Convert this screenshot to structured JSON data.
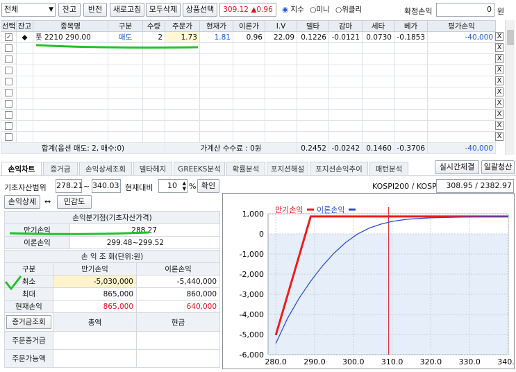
{
  "toolbar": {
    "filter_value": "전체",
    "buttons": [
      "잔고",
      "반전",
      "새로고침",
      "모두삭제",
      "상품선택"
    ],
    "index_value": "309.12",
    "index_change": "▲0.96",
    "radios": [
      {
        "label": "지수",
        "checked": true
      },
      {
        "label": "미니",
        "checked": false
      },
      {
        "label": "위클리",
        "checked": false
      }
    ],
    "realized_label": "확정손익",
    "realized_value": "0",
    "realized_unit": "원"
  },
  "grid": {
    "headers": [
      "선택",
      "잔고",
      "종목명",
      "구분",
      "수량",
      "주문가",
      "현재가",
      "이론가",
      "I.V",
      "델타",
      "감마",
      "세타",
      "베가",
      "평가손익"
    ],
    "row": {
      "checked": true,
      "balance_mark": "◆",
      "name": "풋 2210 290.00",
      "side": "매도",
      "qty": "2",
      "order_price": "1.73",
      "current": "1.81",
      "theory": "0.96",
      "iv": "22.09",
      "delta": "0.1226",
      "gamma": "-0.0121",
      "theta": "0.0730",
      "vega": "-0.1853",
      "pnl": "-40,000"
    },
    "remove_label": "X",
    "summary": {
      "label": "합계(옵션 매도: 2, 매수:0)",
      "fee": "가계산 수수료 : 0원",
      "delta": "0.2452",
      "gamma": "-0.0242",
      "theta": "0.1460",
      "vega": "-0.3706",
      "pnl": "-40,000"
    }
  },
  "tabs": [
    "손익차트",
    "증거금",
    "손익상세조회",
    "델타헤지",
    "GREEKS분석",
    "확률분석",
    "포지션해설",
    "포지션손익추이",
    "패턴분석"
  ],
  "tab_buttons": [
    "실시간체결",
    "일괄청산"
  ],
  "range": {
    "label": "기초자산범위",
    "min": "278.21",
    "sep": "~",
    "max": "340.03",
    "vs_label": "현재대비",
    "pct": "10",
    "pct_unit": "%",
    "confirm": "확인",
    "kospi_label": "KOSPI200 / KOSPI",
    "kospi_value": "308.95 / 2382.97"
  },
  "detail": {
    "button": "손익상세",
    "arrow": "↔",
    "sensitivity": "민감도"
  },
  "breakeven": {
    "title": "손익분기점(기초자산가격)",
    "rows": [
      {
        "label": "만기손익",
        "value": "288.27"
      },
      {
        "label": "이론손익",
        "value": "299.48~299.52"
      }
    ]
  },
  "pnl_table": {
    "title": "손 익 조 회(단위:원)",
    "headers": [
      "구분",
      "만기손익",
      "이론손익"
    ],
    "rows": [
      {
        "label": "최소",
        "expiry": "-5,030,000",
        "theory": "-5,440,000"
      },
      {
        "label": "최대",
        "expiry": "865,000",
        "theory": "860,000"
      },
      {
        "label": "현재손익",
        "expiry": "865,000",
        "theory": "640,000"
      }
    ]
  },
  "margin": {
    "button": "증거금조회",
    "col1": "총액",
    "col2": "현금",
    "rows": [
      "주문증거금",
      "주문가능액"
    ]
  },
  "chart_data": {
    "type": "line",
    "xlim": [
      278,
      340
    ],
    "ylim": [
      -6000,
      1000
    ],
    "xticks": [
      "280.0",
      "290.0",
      "300.0",
      "310.0",
      "320.0",
      "330.0",
      "340.0"
    ],
    "yticks": [
      "1,000",
      "0",
      "-1,000",
      "-2,000",
      "-3,000",
      "-4,000",
      "-5,000",
      "-6,000"
    ],
    "current_x": 309.12,
    "legend": "top-left",
    "series": [
      {
        "name": "만기손익",
        "color": "#ee1c1c",
        "x": [
          280,
          289,
          340
        ],
        "y": [
          -5030,
          865,
          865
        ]
      },
      {
        "name": "이론손익",
        "color": "#2a4fd6",
        "x": [
          280,
          283,
          286,
          289,
          292,
          295,
          298,
          301,
          304,
          307,
          310,
          314,
          320,
          330,
          340
        ],
        "y": [
          -5440,
          -4200,
          -3200,
          -2350,
          -1600,
          -960,
          -430,
          -20,
          280,
          480,
          620,
          730,
          800,
          840,
          860
        ]
      }
    ]
  },
  "colors": {
    "header_bg": "#e9edf2",
    "order_price_bg": "#fff8d6",
    "min_row_bg": "#fff3cc",
    "chart_fill": "#e6eef9"
  }
}
